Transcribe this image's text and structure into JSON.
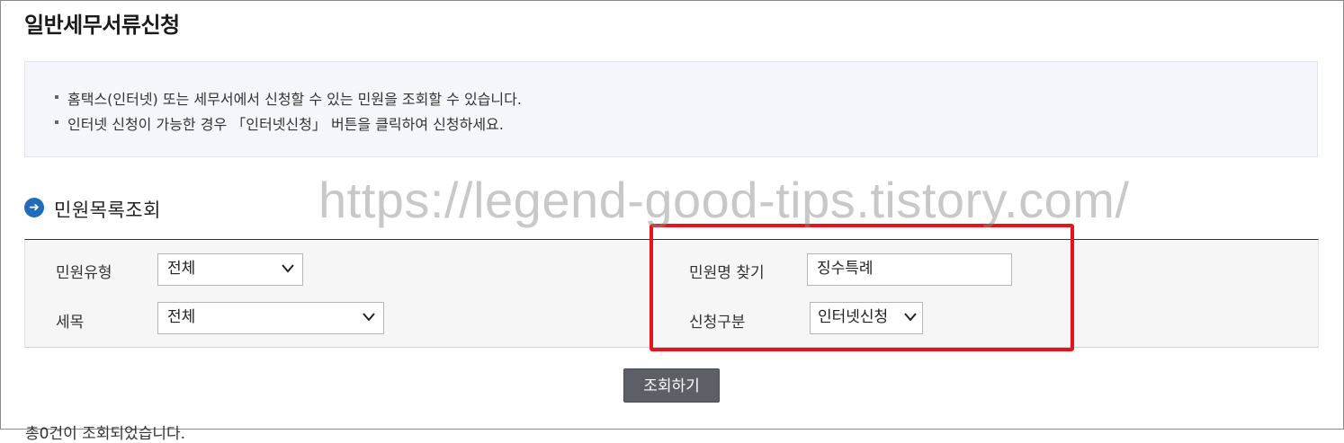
{
  "page": {
    "title": "일반세무서류신청"
  },
  "notice": {
    "lines": [
      "홈택스(인터넷) 또는 세무서에서 신청할 수 있는 민원을 조회할 수 있습니다.",
      "인터넷 신청이 가능한 경우 「인터넷신청」 버튼을 클릭하여 신청하세요."
    ]
  },
  "section": {
    "title": "민원목록조회"
  },
  "watermark": "https://legend-good-tips.tistory.com/",
  "form": {
    "complaint_type": {
      "label": "민원유형",
      "value": "전체"
    },
    "tax_item": {
      "label": "세목",
      "value": "전체"
    },
    "complaint_name": {
      "label": "민원명 찾기",
      "value": "징수특례"
    },
    "apply_type": {
      "label": "신청구분",
      "value": "인터넷신청"
    }
  },
  "search_button": {
    "label": "조회하기"
  },
  "result_summary": "총0건이 조회되었습니다."
}
